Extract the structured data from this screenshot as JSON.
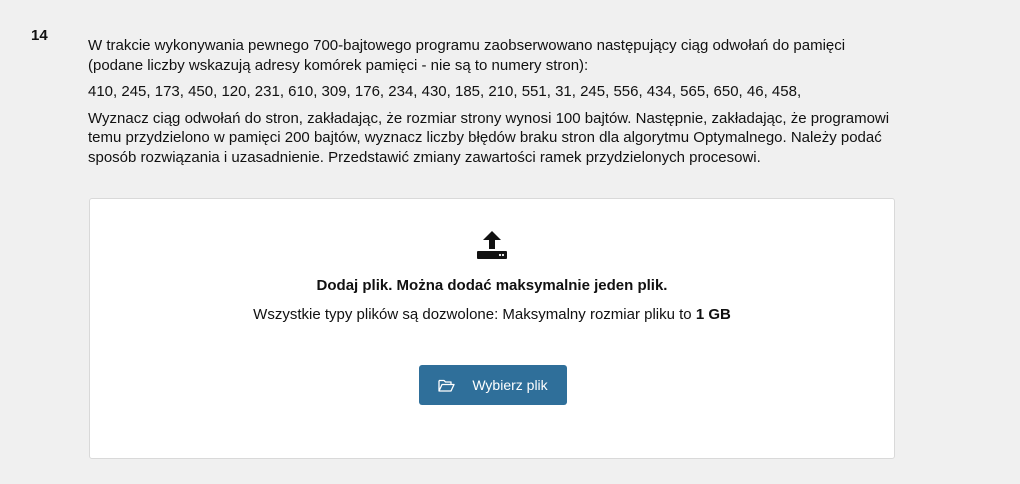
{
  "question": {
    "number": "14",
    "paragraph1": "W trakcie wykonywania pewnego 700-bajtowego programu zaobserwowano następujący ciąg odwołań do pamięci (podane liczby wskazują adresy komórek pamięci - nie są to numery stron):",
    "sequence": "410, 245, 173, 450, 120, 231, 610, 309, 176, 234, 430, 185, 210, 551, 31, 245, 556, 434, 565, 650, 46, 458,",
    "paragraph2": "Wyznacz ciąg odwołań do stron, zakładając, że rozmiar strony wynosi 100 bajtów. Następnie, zakładając, że programowi temu przydzielono w pamięci 200 bajtów, wyznacz liczby błędów braku stron dla algorytmu Optymalnego. Należy podać sposób rozwiązania i uzasadnienie. Przedstawić zmiany zawartości ramek przydzielonych procesowi."
  },
  "upload": {
    "icon": "upload-icon",
    "title": "Dodaj plik. Można dodać maksymalnie jeden plik.",
    "info_prefix": "Wszystkie typy plików są dozwolone: Maksymalny rozmiar pliku to ",
    "max_size": "1 GB",
    "button_icon": "folder-open-icon",
    "button_label": "Wybierz plik"
  },
  "colors": {
    "background": "#f0f0f0",
    "button": "#2f6f9a",
    "box_border": "#d9d9d9"
  }
}
